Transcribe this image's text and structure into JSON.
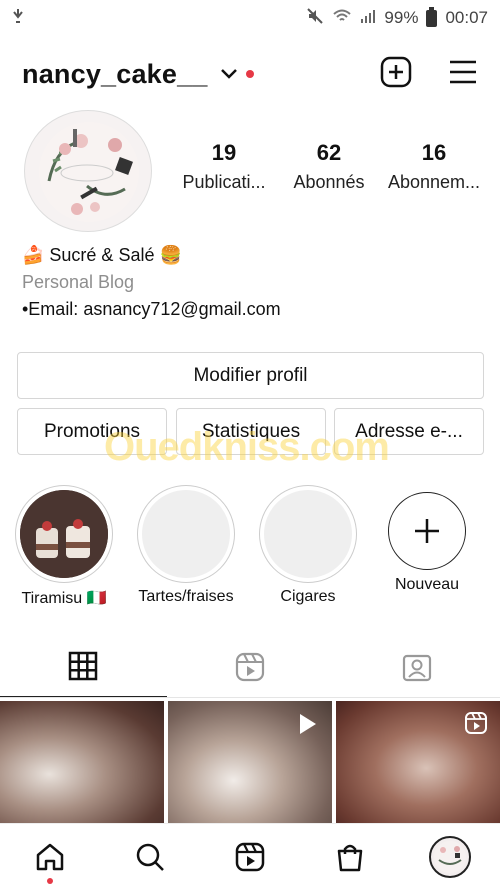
{
  "status": {
    "battery": "99%",
    "time": "00:07"
  },
  "header": {
    "username": "nancy_cake__",
    "icons": [
      "chevron-down-icon",
      "new-post-icon",
      "menu-icon"
    ]
  },
  "stats": [
    {
      "value": "19",
      "label": "Publicati..."
    },
    {
      "value": "62",
      "label": "Abonnés"
    },
    {
      "value": "16",
      "label": "Abonnem..."
    }
  ],
  "bio": {
    "name": "🍰 Sucré & Salé 🍔",
    "category": "Personal Blog",
    "email": "•Email: asnancy712@gmail.com"
  },
  "buttons": {
    "edit_profile": "Modifier profil",
    "promotions": "Promotions",
    "statistics": "Statistiques",
    "email": "Adresse e-..."
  },
  "watermark": "Ouedkniss.com",
  "highlights": [
    {
      "label": "Tiramisu 🇮🇹"
    },
    {
      "label": "Tartes/fraises"
    },
    {
      "label": "Cigares"
    },
    {
      "label": "Nouveau"
    }
  ],
  "tabs": [
    "grid-icon",
    "reels-icon",
    "tagged-icon"
  ],
  "bottom_nav": [
    "home-icon",
    "search-icon",
    "reels-icon",
    "shop-icon",
    "profile-avatar"
  ],
  "colors": {
    "accent_red": "#e63946",
    "border": "#d6d6d6",
    "muted": "#8e8e8e"
  }
}
